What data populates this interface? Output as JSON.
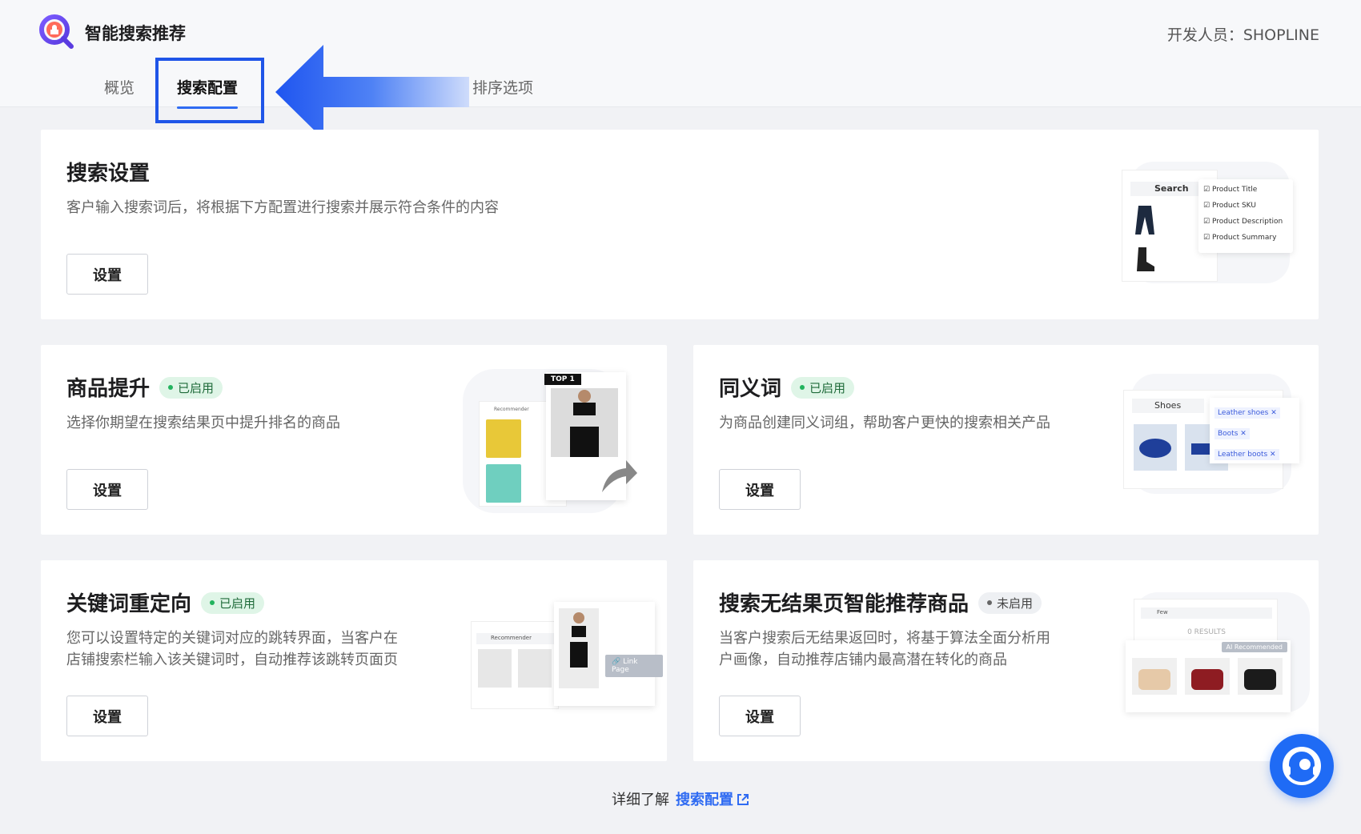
{
  "app": {
    "title": "智能搜索推荐",
    "developer": "开发人员：SHOPLINE"
  },
  "tabs": [
    {
      "label": "概览"
    },
    {
      "label": "搜索配置"
    },
    {
      "label": "排序选项"
    }
  ],
  "cards": {
    "search_settings": {
      "title": "搜索设置",
      "desc": "客户输入搜索词后，将根据下方配置进行搜索并展示符合条件的内容",
      "button": "设置",
      "illus": {
        "search_label": "Search",
        "options": [
          "Product Title",
          "Product SKU",
          "Product Description",
          "Product Summary"
        ]
      }
    },
    "boost": {
      "title": "商品提升",
      "status": "已启用",
      "desc": "选择你期望在搜索结果页中提升排名的商品",
      "button": "设置",
      "illus": {
        "top_label": "TOP 1",
        "list_label": "Recommender"
      }
    },
    "synonyms": {
      "title": "同义词",
      "status": "已启用",
      "desc": "为商品创建同义词组，帮助客户更快的搜索相关产品",
      "button": "设置",
      "illus": {
        "search_term": "Shoes",
        "tags": [
          "Leather shoes",
          "Boots",
          "Leather boots"
        ]
      }
    },
    "redirect": {
      "title": "关键词重定向",
      "status": "已启用",
      "desc_line1": "您可以设置特定的关键词对应的跳转界面，当客户在",
      "desc_line2": "店铺搜索栏输入该关键词时，自动推荐该跳转页面页",
      "button": "设置",
      "illus": {
        "list_label": "Recommender",
        "link_label": "Link Page"
      }
    },
    "no_results": {
      "title": "搜索无结果页智能推荐商品",
      "status": "未启用",
      "desc_line1": "当客户搜索后无结果返回时，将基于算法全面分析用",
      "desc_line2": "户画像，自动推荐店铺内最高潜在转化的商品",
      "button": "设置",
      "illus": {
        "search_term": "Few",
        "results": "0 RESULTS",
        "recommended": "Recommended",
        "ai": "AI"
      }
    }
  },
  "footer": {
    "text": "详细了解",
    "link": "搜索配置"
  },
  "colors": {
    "accent": "#2f6bf2",
    "highlight_box": "#1f55e8",
    "enabled_bg": "#dff5e7",
    "enabled_dot": "#22b35e"
  }
}
